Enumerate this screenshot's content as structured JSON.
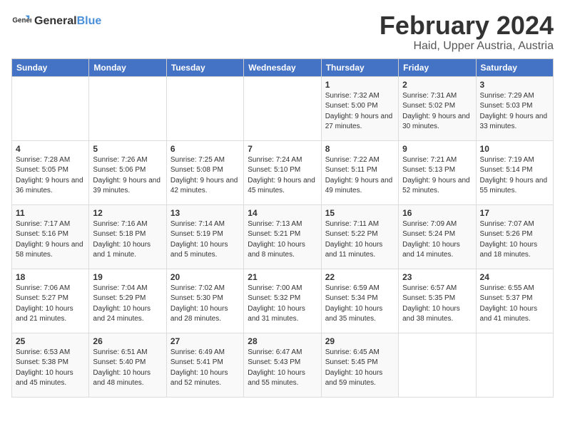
{
  "header": {
    "logo_general": "General",
    "logo_blue": "Blue",
    "main_title": "February 2024",
    "sub_title": "Haid, Upper Austria, Austria"
  },
  "days_of_week": [
    "Sunday",
    "Monday",
    "Tuesday",
    "Wednesday",
    "Thursday",
    "Friday",
    "Saturday"
  ],
  "weeks": [
    [
      {
        "day": "",
        "sunrise": "",
        "sunset": "",
        "daylight": ""
      },
      {
        "day": "",
        "sunrise": "",
        "sunset": "",
        "daylight": ""
      },
      {
        "day": "",
        "sunrise": "",
        "sunset": "",
        "daylight": ""
      },
      {
        "day": "",
        "sunrise": "",
        "sunset": "",
        "daylight": ""
      },
      {
        "day": "1",
        "sunrise": "Sunrise: 7:32 AM",
        "sunset": "Sunset: 5:00 PM",
        "daylight": "Daylight: 9 hours and 27 minutes."
      },
      {
        "day": "2",
        "sunrise": "Sunrise: 7:31 AM",
        "sunset": "Sunset: 5:02 PM",
        "daylight": "Daylight: 9 hours and 30 minutes."
      },
      {
        "day": "3",
        "sunrise": "Sunrise: 7:29 AM",
        "sunset": "Sunset: 5:03 PM",
        "daylight": "Daylight: 9 hours and 33 minutes."
      }
    ],
    [
      {
        "day": "4",
        "sunrise": "Sunrise: 7:28 AM",
        "sunset": "Sunset: 5:05 PM",
        "daylight": "Daylight: 9 hours and 36 minutes."
      },
      {
        "day": "5",
        "sunrise": "Sunrise: 7:26 AM",
        "sunset": "Sunset: 5:06 PM",
        "daylight": "Daylight: 9 hours and 39 minutes."
      },
      {
        "day": "6",
        "sunrise": "Sunrise: 7:25 AM",
        "sunset": "Sunset: 5:08 PM",
        "daylight": "Daylight: 9 hours and 42 minutes."
      },
      {
        "day": "7",
        "sunrise": "Sunrise: 7:24 AM",
        "sunset": "Sunset: 5:10 PM",
        "daylight": "Daylight: 9 hours and 45 minutes."
      },
      {
        "day": "8",
        "sunrise": "Sunrise: 7:22 AM",
        "sunset": "Sunset: 5:11 PM",
        "daylight": "Daylight: 9 hours and 49 minutes."
      },
      {
        "day": "9",
        "sunrise": "Sunrise: 7:21 AM",
        "sunset": "Sunset: 5:13 PM",
        "daylight": "Daylight: 9 hours and 52 minutes."
      },
      {
        "day": "10",
        "sunrise": "Sunrise: 7:19 AM",
        "sunset": "Sunset: 5:14 PM",
        "daylight": "Daylight: 9 hours and 55 minutes."
      }
    ],
    [
      {
        "day": "11",
        "sunrise": "Sunrise: 7:17 AM",
        "sunset": "Sunset: 5:16 PM",
        "daylight": "Daylight: 9 hours and 58 minutes."
      },
      {
        "day": "12",
        "sunrise": "Sunrise: 7:16 AM",
        "sunset": "Sunset: 5:18 PM",
        "daylight": "Daylight: 10 hours and 1 minute."
      },
      {
        "day": "13",
        "sunrise": "Sunrise: 7:14 AM",
        "sunset": "Sunset: 5:19 PM",
        "daylight": "Daylight: 10 hours and 5 minutes."
      },
      {
        "day": "14",
        "sunrise": "Sunrise: 7:13 AM",
        "sunset": "Sunset: 5:21 PM",
        "daylight": "Daylight: 10 hours and 8 minutes."
      },
      {
        "day": "15",
        "sunrise": "Sunrise: 7:11 AM",
        "sunset": "Sunset: 5:22 PM",
        "daylight": "Daylight: 10 hours and 11 minutes."
      },
      {
        "day": "16",
        "sunrise": "Sunrise: 7:09 AM",
        "sunset": "Sunset: 5:24 PM",
        "daylight": "Daylight: 10 hours and 14 minutes."
      },
      {
        "day": "17",
        "sunrise": "Sunrise: 7:07 AM",
        "sunset": "Sunset: 5:26 PM",
        "daylight": "Daylight: 10 hours and 18 minutes."
      }
    ],
    [
      {
        "day": "18",
        "sunrise": "Sunrise: 7:06 AM",
        "sunset": "Sunset: 5:27 PM",
        "daylight": "Daylight: 10 hours and 21 minutes."
      },
      {
        "day": "19",
        "sunrise": "Sunrise: 7:04 AM",
        "sunset": "Sunset: 5:29 PM",
        "daylight": "Daylight: 10 hours and 24 minutes."
      },
      {
        "day": "20",
        "sunrise": "Sunrise: 7:02 AM",
        "sunset": "Sunset: 5:30 PM",
        "daylight": "Daylight: 10 hours and 28 minutes."
      },
      {
        "day": "21",
        "sunrise": "Sunrise: 7:00 AM",
        "sunset": "Sunset: 5:32 PM",
        "daylight": "Daylight: 10 hours and 31 minutes."
      },
      {
        "day": "22",
        "sunrise": "Sunrise: 6:59 AM",
        "sunset": "Sunset: 5:34 PM",
        "daylight": "Daylight: 10 hours and 35 minutes."
      },
      {
        "day": "23",
        "sunrise": "Sunrise: 6:57 AM",
        "sunset": "Sunset: 5:35 PM",
        "daylight": "Daylight: 10 hours and 38 minutes."
      },
      {
        "day": "24",
        "sunrise": "Sunrise: 6:55 AM",
        "sunset": "Sunset: 5:37 PM",
        "daylight": "Daylight: 10 hours and 41 minutes."
      }
    ],
    [
      {
        "day": "25",
        "sunrise": "Sunrise: 6:53 AM",
        "sunset": "Sunset: 5:38 PM",
        "daylight": "Daylight: 10 hours and 45 minutes."
      },
      {
        "day": "26",
        "sunrise": "Sunrise: 6:51 AM",
        "sunset": "Sunset: 5:40 PM",
        "daylight": "Daylight: 10 hours and 48 minutes."
      },
      {
        "day": "27",
        "sunrise": "Sunrise: 6:49 AM",
        "sunset": "Sunset: 5:41 PM",
        "daylight": "Daylight: 10 hours and 52 minutes."
      },
      {
        "day": "28",
        "sunrise": "Sunrise: 6:47 AM",
        "sunset": "Sunset: 5:43 PM",
        "daylight": "Daylight: 10 hours and 55 minutes."
      },
      {
        "day": "29",
        "sunrise": "Sunrise: 6:45 AM",
        "sunset": "Sunset: 5:45 PM",
        "daylight": "Daylight: 10 hours and 59 minutes."
      },
      {
        "day": "",
        "sunrise": "",
        "sunset": "",
        "daylight": ""
      },
      {
        "day": "",
        "sunrise": "",
        "sunset": "",
        "daylight": ""
      }
    ]
  ]
}
